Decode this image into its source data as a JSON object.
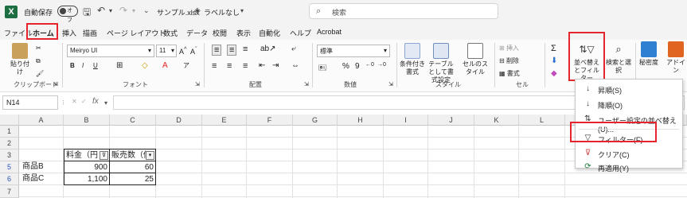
{
  "titlebar": {
    "logo": "X",
    "autosave_label": "自動保存",
    "autosave_state": "オフ",
    "filename": "サンプル.xlsx",
    "sensitivity": "ラベルなし",
    "search_placeholder": "検索"
  },
  "menu_tabs": [
    "ファイル",
    "ホーム",
    "挿入",
    "描画",
    "ページ レイアウト",
    "数式",
    "データ",
    "校閲",
    "表示",
    "自動化",
    "ヘルプ",
    "Acrobat"
  ],
  "ribbon": {
    "paste": "貼り付け",
    "clipboard": "クリップボード",
    "font_name": "Meiryo UI",
    "font_size": "11",
    "font": "フォント",
    "alignment": "配置",
    "number_format": "標準",
    "number": "数値",
    "conditional_format": "条件付き書式",
    "table_format": "テーブルとして書式設定",
    "cell_styles": "セルのスタイル",
    "styles": "スタイル",
    "insert": "挿入",
    "delete": "削除",
    "format": "書式",
    "cells": "セル",
    "sort_filter": "並べ替えとフィルター",
    "find_select": "検索と選択",
    "sensitivity": "秘密度",
    "addins": "アドイン"
  },
  "formula_bar": {
    "name_box": "N14",
    "fx": "fx"
  },
  "columns": [
    "A",
    "B",
    "C",
    "D",
    "E",
    "F",
    "G",
    "H",
    "I",
    "J",
    "K",
    "L",
    "M"
  ],
  "rows": [
    "1",
    "2",
    "3",
    "5",
    "6",
    "7"
  ],
  "sheet": {
    "header_b": "料金（円",
    "header_c": "販売数（個",
    "r5_a": "商品B",
    "r5_b": "900",
    "r5_c": "60",
    "r6_a": "商品C",
    "r6_b": "1,100",
    "r6_c": "25"
  },
  "dropdown": {
    "asc": "昇順(S)",
    "desc": "降順(O)",
    "custom": "ユーザー設定の並べ替え(U)...",
    "filter": "フィルター(F)",
    "clear": "クリア(C)",
    "reapply": "再適用(Y)"
  },
  "colors": {
    "excel_green": "#1d6f42",
    "highlight_red": "#e4262c",
    "selected_row_blue": "#2b55b8"
  }
}
